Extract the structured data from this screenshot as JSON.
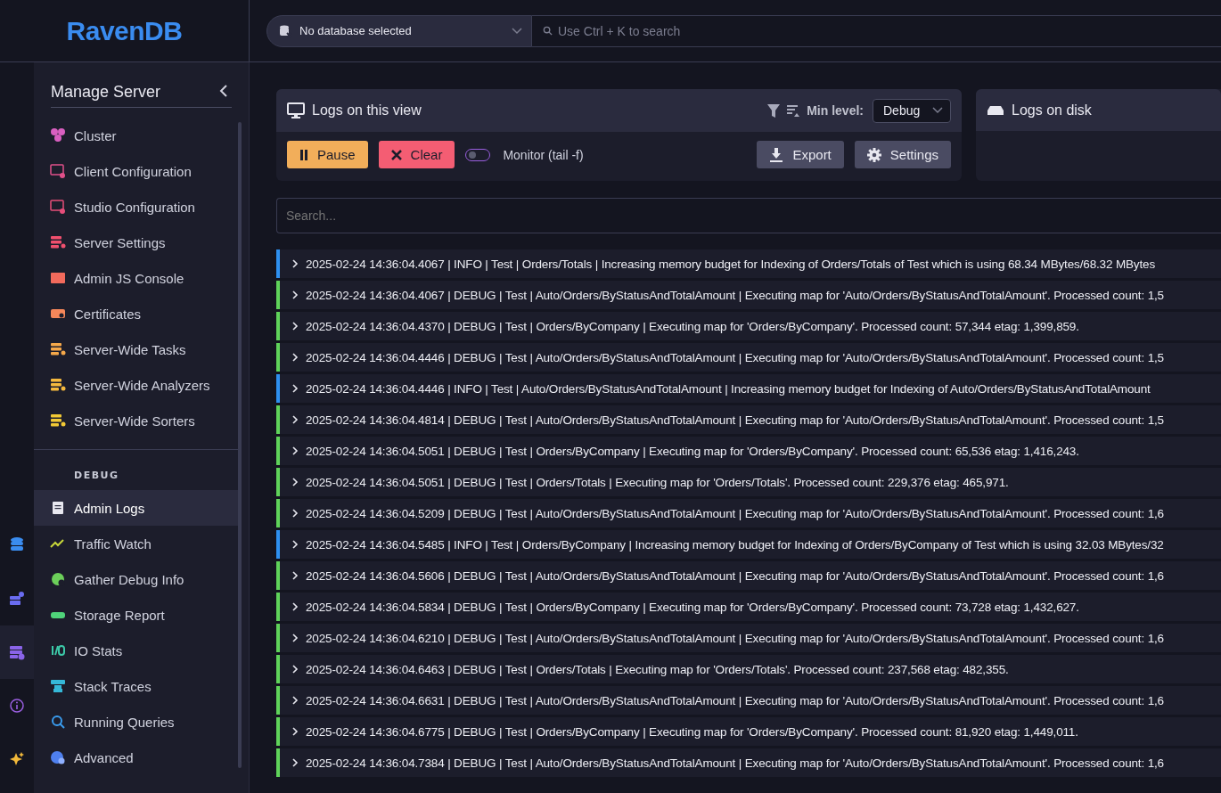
{
  "logo": {
    "text": "RavenDB"
  },
  "database_selector": {
    "value": "No database selected"
  },
  "global_search": {
    "placeholder": "Use Ctrl + K to search"
  },
  "rail": [
    {
      "selected": false
    },
    {
      "selected": false
    },
    {
      "selected": true
    },
    {
      "selected": false
    },
    {
      "selected": false
    }
  ],
  "sidebar": {
    "title": "Manage Server",
    "items": [
      {
        "label": "Cluster",
        "selected": false
      },
      {
        "label": "Client Configuration",
        "selected": false
      },
      {
        "label": "Studio Configuration",
        "selected": false
      },
      {
        "label": "Server Settings",
        "selected": false
      },
      {
        "label": "Admin JS Console",
        "selected": false
      },
      {
        "label": "Certificates",
        "selected": false
      },
      {
        "label": "Server-Wide Tasks",
        "selected": false
      },
      {
        "label": "Server-Wide Analyzers",
        "selected": false
      },
      {
        "label": "Server-Wide Sorters",
        "selected": false
      }
    ],
    "section": "DEBUG",
    "debug_items": [
      {
        "label": "Admin Logs",
        "selected": true
      },
      {
        "label": "Traffic Watch",
        "selected": false
      },
      {
        "label": "Gather Debug Info",
        "selected": false
      },
      {
        "label": "Storage Report",
        "selected": false
      },
      {
        "label": "IO Stats",
        "selected": false
      },
      {
        "label": "Stack Traces",
        "selected": false
      },
      {
        "label": "Running Queries",
        "selected": false
      },
      {
        "label": "Advanced",
        "selected": false
      }
    ]
  },
  "view_card": {
    "title": "Logs on this view",
    "min_level_label": "Min level:",
    "min_level": "Debug",
    "pause": "Pause",
    "clear": "Clear",
    "monitor": {
      "label": "Monitor (tail -f)",
      "on": false
    },
    "export": "Export",
    "settings": "Settings"
  },
  "disk_card": {
    "title": "Logs on disk"
  },
  "log_search": {
    "placeholder": "Search..."
  },
  "logs": [
    {
      "text": "2025-02-24 14:36:04.4067 | INFO | Test | Orders/Totals | Increasing memory budget for Indexing of Orders/Totals of Test which is using 68.34 MBytes/68.32 MBytes",
      "color": "#2e90f0"
    },
    {
      "text": "2025-02-24 14:36:04.4067 | DEBUG | Test | Auto/Orders/ByStatusAndTotalAmount | Executing map for 'Auto/Orders/ByStatusAndTotalAmount'. Processed count: 1,5",
      "color": "#5fd35a"
    },
    {
      "text": "2025-02-24 14:36:04.4370 | DEBUG | Test | Orders/ByCompany | Executing map for 'Orders/ByCompany'. Processed count: 57,344 etag: 1,399,859.",
      "color": "#5fd35a"
    },
    {
      "text": "2025-02-24 14:36:04.4446 | DEBUG | Test | Auto/Orders/ByStatusAndTotalAmount | Executing map for 'Auto/Orders/ByStatusAndTotalAmount'. Processed count: 1,5",
      "color": "#5fd35a"
    },
    {
      "text": "2025-02-24 14:36:04.4446 | INFO | Test | Auto/Orders/ByStatusAndTotalAmount | Increasing memory budget for Indexing of Auto/Orders/ByStatusAndTotalAmount",
      "color": "#2e90f0"
    },
    {
      "text": "2025-02-24 14:36:04.4814 | DEBUG | Test | Auto/Orders/ByStatusAndTotalAmount | Executing map for 'Auto/Orders/ByStatusAndTotalAmount'. Processed count: 1,5",
      "color": "#5fd35a"
    },
    {
      "text": "2025-02-24 14:36:04.5051 | DEBUG | Test | Orders/ByCompany | Executing map for 'Orders/ByCompany'. Processed count: 65,536 etag: 1,416,243.",
      "color": "#5fd35a"
    },
    {
      "text": "2025-02-24 14:36:04.5051 | DEBUG | Test | Orders/Totals | Executing map for 'Orders/Totals'. Processed count: 229,376 etag: 465,971.",
      "color": "#5fd35a"
    },
    {
      "text": "2025-02-24 14:36:04.5209 | DEBUG | Test | Auto/Orders/ByStatusAndTotalAmount | Executing map for 'Auto/Orders/ByStatusAndTotalAmount'. Processed count: 1,6",
      "color": "#5fd35a"
    },
    {
      "text": "2025-02-24 14:36:04.5485 | INFO | Test | Orders/ByCompany | Increasing memory budget for Indexing of Orders/ByCompany of Test which is using 32.03 MBytes/32",
      "color": "#2e90f0"
    },
    {
      "text": "2025-02-24 14:36:04.5606 | DEBUG | Test | Auto/Orders/ByStatusAndTotalAmount | Executing map for 'Auto/Orders/ByStatusAndTotalAmount'. Processed count: 1,6",
      "color": "#5fd35a"
    },
    {
      "text": "2025-02-24 14:36:04.5834 | DEBUG | Test | Orders/ByCompany | Executing map for 'Orders/ByCompany'. Processed count: 73,728 etag: 1,432,627.",
      "color": "#5fd35a"
    },
    {
      "text": "2025-02-24 14:36:04.6210 | DEBUG | Test | Auto/Orders/ByStatusAndTotalAmount | Executing map for 'Auto/Orders/ByStatusAndTotalAmount'. Processed count: 1,6",
      "color": "#5fd35a"
    },
    {
      "text": "2025-02-24 14:36:04.6463 | DEBUG | Test | Orders/Totals | Executing map for 'Orders/Totals'. Processed count: 237,568 etag: 482,355.",
      "color": "#5fd35a"
    },
    {
      "text": "2025-02-24 14:36:04.6631 | DEBUG | Test | Auto/Orders/ByStatusAndTotalAmount | Executing map for 'Auto/Orders/ByStatusAndTotalAmount'. Processed count: 1,6",
      "color": "#5fd35a"
    },
    {
      "text": "2025-02-24 14:36:04.6775 | DEBUG | Test | Orders/ByCompany | Executing map for 'Orders/ByCompany'. Processed count: 81,920 etag: 1,449,011.",
      "color": "#5fd35a"
    },
    {
      "text": "2025-02-24 14:36:04.7384 | DEBUG | Test | Auto/Orders/ByStatusAndTotalAmount | Executing map for 'Auto/Orders/ByStatusAndTotalAmount'. Processed count: 1,6",
      "color": "#5fd35a"
    }
  ]
}
